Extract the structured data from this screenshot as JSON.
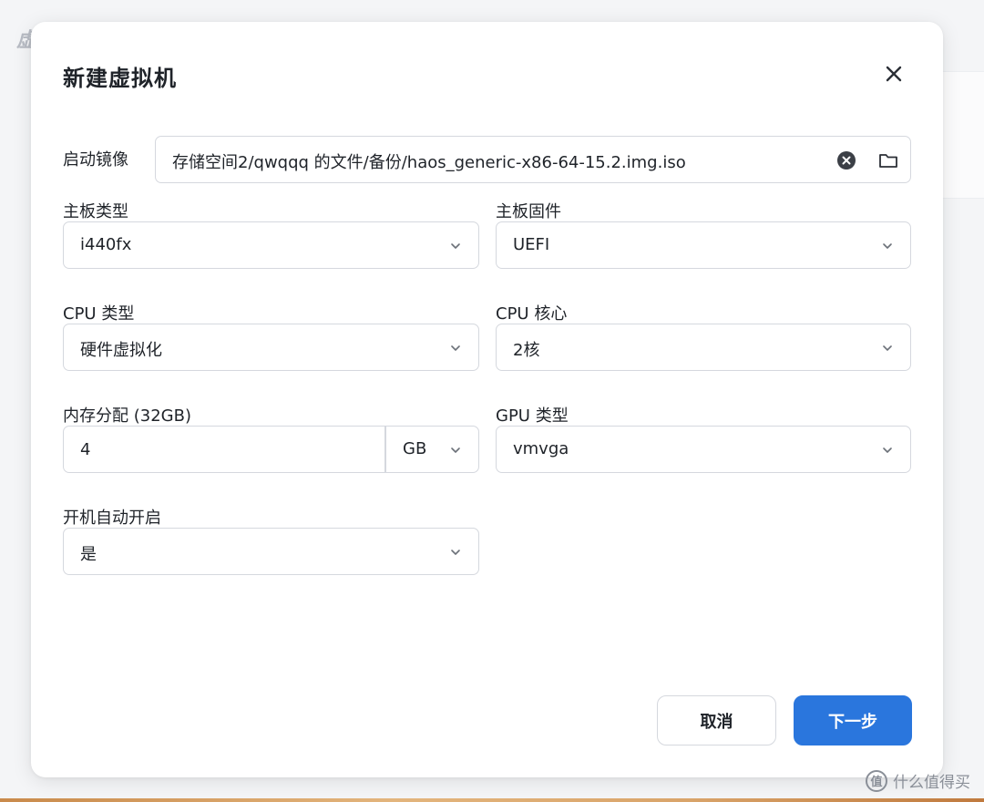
{
  "background": {
    "fragment_text": "虚"
  },
  "dialog": {
    "title": "新建虚拟机",
    "close_icon": "close-icon"
  },
  "form": {
    "boot_image": {
      "label": "启动镜像",
      "value": "存储空间2/qwqqq 的文件/备份/haos_generic-x86-64-15.2.img.iso",
      "clear_icon": "clear-circle-icon",
      "browse_icon": "folder-icon"
    },
    "board_type": {
      "label": "主板类型",
      "value": "i440fx"
    },
    "board_firmware": {
      "label": "主板固件",
      "value": "UEFI"
    },
    "cpu_type": {
      "label": "CPU 类型",
      "value": "硬件虚拟化"
    },
    "cpu_cores": {
      "label": "CPU 核心",
      "value": "2核"
    },
    "memory": {
      "label": "内存分配 (32GB)",
      "value": "4",
      "unit": "GB"
    },
    "gpu_type": {
      "label": "GPU 类型",
      "value": "vmvga"
    },
    "autostart": {
      "label": "开机自动开启",
      "value": "是"
    }
  },
  "buttons": {
    "cancel": "取消",
    "next": "下一步"
  },
  "watermark": {
    "logo": "值",
    "text": "什么值得买"
  },
  "colors": {
    "primary": "#2a76dd",
    "border": "#d5d8de",
    "text": "#1f2329"
  }
}
